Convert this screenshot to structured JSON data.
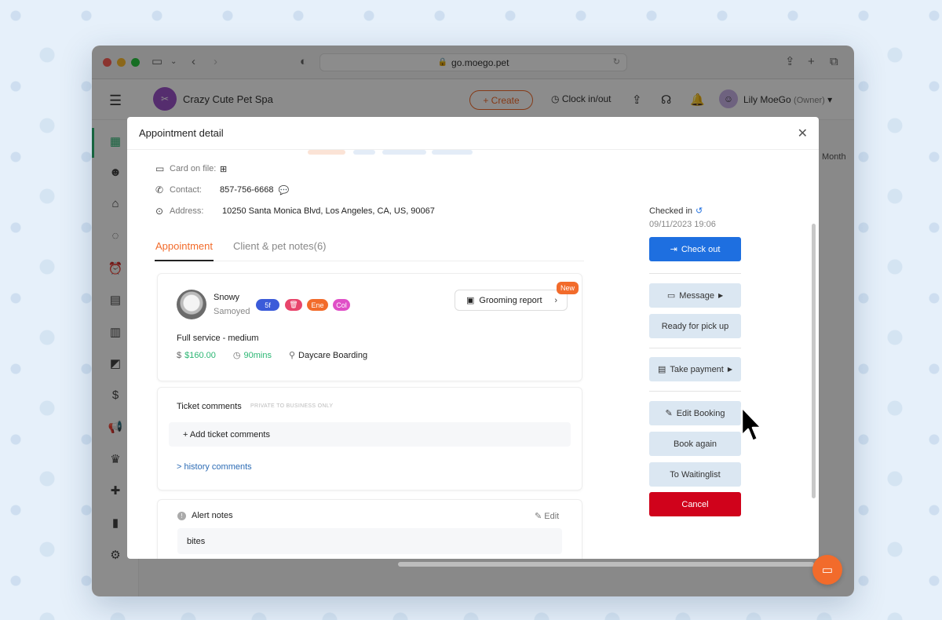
{
  "browser": {
    "url": "go.moego.pet"
  },
  "app": {
    "business_name": "Crazy Cute Pet Spa",
    "create_label": "+ Create",
    "clock_label": "Clock in/out",
    "user_name": "Lily MoeGo",
    "user_role": "(Owner)",
    "view_month_label": "Month"
  },
  "modal": {
    "title": "Appointment detail",
    "client_info": {
      "card_label": "Card on file:",
      "contact_label": "Contact:",
      "contact_value": "857-756-6668",
      "address_label": "Address:",
      "address_value": "10250 Santa Monica Blvd, Los Angeles, CA, US, 90067"
    },
    "tabs": [
      {
        "label": "Appointment",
        "active": true
      },
      {
        "label": "Client & pet notes(6)",
        "active": false
      }
    ],
    "pet": {
      "name": "Snowy",
      "breed": "Samoyed",
      "tags": [
        {
          "text": "5f",
          "color": "#3b5bd9"
        },
        {
          "text": "🗑",
          "color": "#e8456b"
        },
        {
          "text": "Ene",
          "color": "#f26b2b"
        },
        {
          "text": "Col",
          "color": "#e04fc7"
        }
      ],
      "grooming_report_label": "Grooming report",
      "new_badge": "New",
      "service_name": "Full service - medium",
      "price": "$160.00",
      "duration": "90mins",
      "staff": "Daycare Boarding"
    },
    "ticket_comments": {
      "title": "Ticket comments",
      "private_note": "PRIVATE TO BUSINESS ONLY",
      "add_label": "+ Add ticket comments",
      "history_label": "> history comments"
    },
    "alert_notes": {
      "title": "Alert notes",
      "edit_label": "Edit",
      "body": "bites"
    },
    "status": {
      "label": "Checked in",
      "time": "09/11/2023 19:06"
    },
    "actions": {
      "check_out": "Check out",
      "message": "Message",
      "ready": "Ready for pick up",
      "take_payment": "Take payment",
      "edit_booking": "Edit Booking",
      "book_again": "Book again",
      "waitlist": "To Waitinglist",
      "cancel": "Cancel"
    }
  }
}
